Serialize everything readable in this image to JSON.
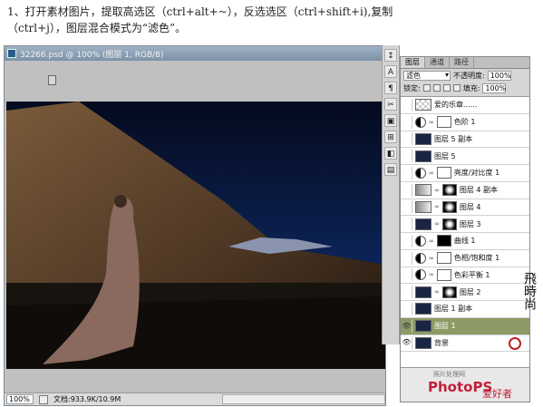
{
  "instruction": {
    "line1": "1、打开素材图片，提取高选区（ctrl+alt+~），反选选区（ctrl+shift+i),复制",
    "line2": "（ctrl+j），图层混合模式为“滤色”。"
  },
  "document": {
    "title": "32266.psd @ 100% (图层 1, RGB/8)",
    "zoom": "100%",
    "doc_size": "文档:933.9K/10.9M"
  },
  "tools": [
    "↕",
    "A",
    "¶",
    "✂",
    "▣",
    "⊞",
    "◧",
    "▤"
  ],
  "layers_panel": {
    "tabs": [
      "图层",
      "通道",
      "路径"
    ],
    "blend_mode": "滤色",
    "opacity_label": "不透明度:",
    "opacity_value": "100%",
    "lock_label": "锁定:",
    "fill_label": "填充:",
    "fill_value": "100%",
    "layers": [
      {
        "name": "爱的乐章......",
        "thumb": "pattern",
        "mask": ""
      },
      {
        "name": "色阶 1",
        "thumb": "adj",
        "mask": "white"
      },
      {
        "name": "图层 5 副本",
        "thumb": "photo",
        "mask": ""
      },
      {
        "name": "图层 5",
        "thumb": "photo",
        "mask": ""
      },
      {
        "name": "亮度/对比度 1",
        "thumb": "adj",
        "mask": "white"
      },
      {
        "name": "图层 4 副本",
        "thumb": "gray",
        "mask": "dark"
      },
      {
        "name": "图层 4",
        "thumb": "gray",
        "mask": "dark"
      },
      {
        "name": "图层 3",
        "thumb": "photo",
        "mask": "dark"
      },
      {
        "name": "曲线 1",
        "thumb": "adj",
        "mask": "black"
      },
      {
        "name": "色相/饱和度 1",
        "thumb": "adj",
        "mask": "white"
      },
      {
        "name": "色彩平衡 1",
        "thumb": "adj",
        "mask": "white"
      },
      {
        "name": "图层 2",
        "thumb": "photo",
        "mask": "dark"
      },
      {
        "name": "图层 1 副本",
        "thumb": "photo",
        "mask": ""
      },
      {
        "name": "图层 1",
        "thumb": "photo",
        "mask": "",
        "selected": true
      },
      {
        "name": "背景",
        "thumb": "photo",
        "mask": ""
      }
    ]
  },
  "watermark": {
    "line1": "照片处理网",
    "brand": "PhotoPS",
    "suffix": "爱好者"
  },
  "seal_text": "飛時尚"
}
